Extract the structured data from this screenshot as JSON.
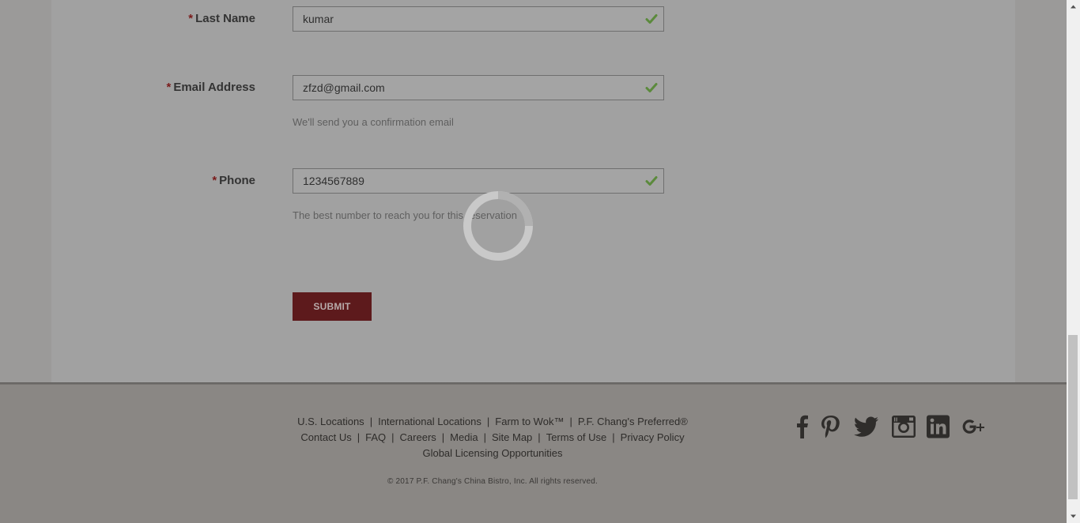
{
  "form": {
    "last_name": {
      "label": "Last Name",
      "required_mark": "*",
      "value": "kumar"
    },
    "email": {
      "label": "Email Address",
      "required_mark": "*",
      "value": "zfzd@gmail.com",
      "hint": "We'll send you a confirmation email"
    },
    "phone": {
      "label": "Phone",
      "required_mark": "*",
      "value": "1234567889",
      "hint": "The best number to reach you for this reservation"
    },
    "submit_label": "SUBMIT"
  },
  "colors": {
    "accent": "#5d1a1c",
    "valid_check": "#5b8a3c",
    "overlay": "#8a8784"
  },
  "footer": {
    "links_row1": [
      "U.S. Locations",
      "International Locations",
      "Farm to Wok™",
      "P.F. Chang's Preferred®"
    ],
    "links_row2": [
      "Contact Us",
      "FAQ",
      "Careers",
      "Media",
      "Site Map",
      "Terms of Use",
      "Privacy Policy"
    ],
    "links_row3": [
      "Global Licensing Opportunities"
    ],
    "copyright": "© 2017 P.F. Chang's China Bistro, Inc. All rights reserved.",
    "social_icons": [
      "facebook-icon",
      "pinterest-icon",
      "twitter-icon",
      "instagram-icon",
      "linkedin-icon",
      "google-plus-icon"
    ]
  },
  "loading": {
    "icon": "loading-spinner-icon"
  }
}
